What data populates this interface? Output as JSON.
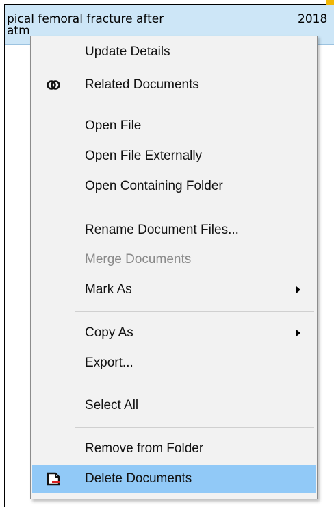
{
  "list_row": {
    "title_line1": "pical femoral fracture after",
    "title_line2": "atm",
    "year": "2018"
  },
  "menu": {
    "items": [
      {
        "label": "Update Details",
        "enabled": true
      },
      {
        "label": "Related Documents",
        "icon": "related-documents-icon",
        "enabled": true
      },
      {
        "label": "Open File",
        "enabled": true
      },
      {
        "label": "Open File Externally",
        "enabled": true
      },
      {
        "label": "Open Containing Folder",
        "enabled": true
      },
      {
        "label": "Rename Document Files...",
        "enabled": true
      },
      {
        "label": "Merge Documents",
        "enabled": false
      },
      {
        "label": "Mark As",
        "submenu": true,
        "enabled": true
      },
      {
        "label": "Copy As",
        "submenu": true,
        "enabled": true
      },
      {
        "label": "Export...",
        "enabled": true
      },
      {
        "label": "Select All",
        "enabled": true
      },
      {
        "label": "Remove from Folder",
        "enabled": true
      },
      {
        "label": "Delete Documents",
        "icon": "delete-documents-icon",
        "enabled": true,
        "highlighted": true
      }
    ]
  },
  "colors": {
    "row_selected": "#cde6f7",
    "menu_bg": "#f2f2f2",
    "highlight": "#91c9f7",
    "accent": "#f2b705",
    "delete_icon_red": "#d92020"
  }
}
